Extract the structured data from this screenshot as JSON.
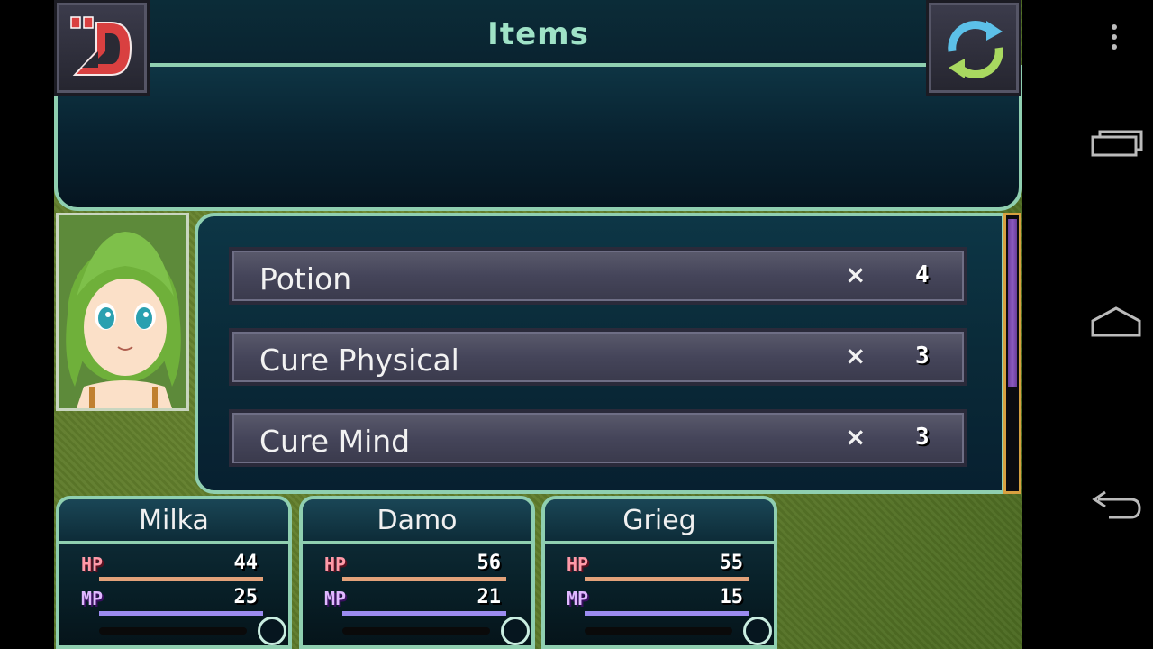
{
  "header": {
    "title": "Items"
  },
  "items": [
    {
      "name": "Potion",
      "times": "×",
      "qty": "4"
    },
    {
      "name": "Cure Physical",
      "times": "×",
      "qty": "3"
    },
    {
      "name": "Cure Mind",
      "times": "×",
      "qty": "3"
    }
  ],
  "party": [
    {
      "name": "Milka",
      "hp_label": "HP",
      "hp": "44",
      "mp_label": "MP",
      "mp": "25"
    },
    {
      "name": "Damo",
      "hp_label": "HP",
      "hp": "56",
      "mp_label": "MP",
      "mp": "21"
    },
    {
      "name": "Grieg",
      "hp_label": "HP",
      "hp": "55",
      "mp_label": "MP",
      "mp": "15"
    }
  ],
  "icons": {
    "back": "back-d-icon",
    "refresh": "refresh-icon",
    "menu": "overflow-menu-icon",
    "recents": "recent-apps-icon",
    "home": "home-icon",
    "nav_back": "back-arrow-icon"
  },
  "colors": {
    "accent": "#8fcfb0",
    "title": "#9fe3c7",
    "hp": "#ff9aa8",
    "mp": "#e0b8ff"
  }
}
